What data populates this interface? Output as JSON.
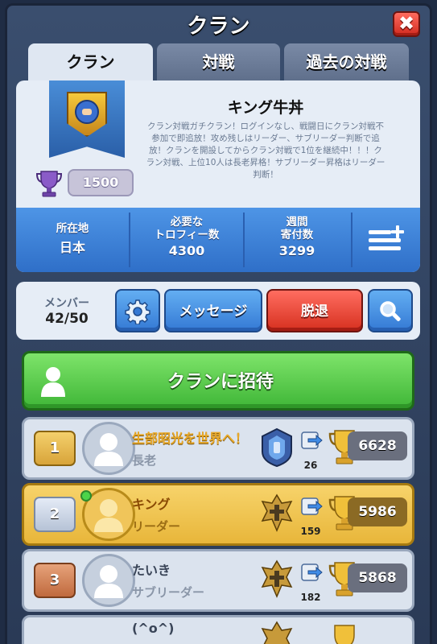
{
  "header": {
    "title": "クラン",
    "close_label": "✖"
  },
  "tabs": [
    {
      "label": "クラン"
    },
    {
      "label": "対戦"
    },
    {
      "label": "過去の対戦"
    }
  ],
  "clan": {
    "name": "キング牛丼",
    "description": "クラン対戦ガチクラン！ログインなし、戦闘日にクラン対戦不参加で即追放！攻め残しはリーダー、サブリーダー判断で追放！クランを開設してからクラン対戦で1位を継続中！！！クラン対戦、上位10人は長老昇格！サブリーダー昇格はリーダー判断！",
    "trophies": "1500",
    "stats": {
      "location_label": "所在地",
      "location_value": "日本",
      "required_label_1": "必要な",
      "required_label_2": "トロフィー数",
      "required_value": "4300",
      "donation_label_1": "週間",
      "donation_label_2": "寄付数",
      "donation_value": "3299"
    }
  },
  "members_bar": {
    "label": "メンバー",
    "count": "42/50",
    "message_label": "メッセージ",
    "leave_label": "脱退"
  },
  "invite": {
    "label": "クランに招待"
  },
  "members": [
    {
      "rank": "1",
      "name": "生部昭光を世界へ！",
      "role": "長老",
      "donations": "26",
      "trophies": "6628"
    },
    {
      "rank": "2",
      "name": "キング",
      "role": "リーダー",
      "donations": "159",
      "trophies": "5986"
    },
    {
      "rank": "3",
      "name": "たいき",
      "role": "サブリーダー",
      "donations": "182",
      "trophies": "5868"
    },
    {
      "rank": "",
      "name": "(^o^)",
      "role": "",
      "donations": "",
      "trophies": ""
    }
  ],
  "colors": {
    "stats_blue": "#3f84d8",
    "invite_green": "#4fc443",
    "leave_red": "#e03a2a",
    "self_gold": "#f0c44c"
  }
}
